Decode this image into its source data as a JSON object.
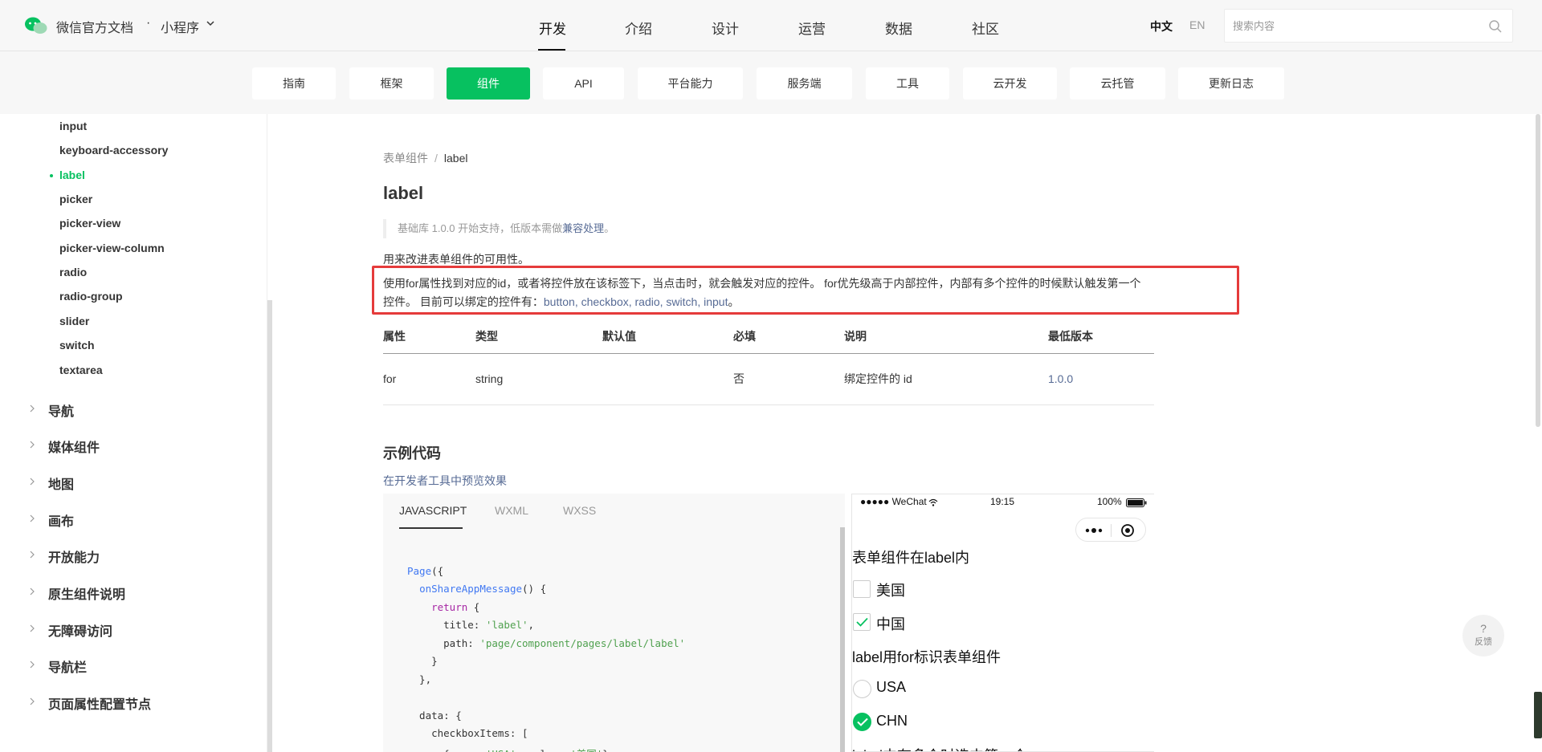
{
  "header": {
    "brand": "微信官方文档",
    "dot": "·",
    "product": "小程序",
    "nav": [
      "开发",
      "介绍",
      "设计",
      "运营",
      "数据",
      "社区"
    ],
    "lang_zh": "中文",
    "lang_en": "EN",
    "search_placeholder": "搜索内容"
  },
  "subnav": {
    "tabs": [
      "指南",
      "框架",
      "组件",
      "API",
      "平台能力",
      "服务端",
      "工具",
      "云开发",
      "云托管",
      "更新日志"
    ],
    "active": "组件"
  },
  "sidebar": {
    "sub_items": [
      "input",
      "keyboard-accessory",
      "label",
      "picker",
      "picker-view",
      "picker-view-column",
      "radio",
      "radio-group",
      "slider",
      "switch",
      "textarea"
    ],
    "active": "label",
    "groups": [
      "导航",
      "媒体组件",
      "地图",
      "画布",
      "开放能力",
      "原生组件说明",
      "无障碍访问",
      "导航栏",
      "页面属性配置节点"
    ]
  },
  "content": {
    "breadcrumb_parent": "表单组件",
    "breadcrumb_sep": "/",
    "breadcrumb_current": "label",
    "title": "label",
    "support_prefix": "基础库 1.0.0 开始支持，低版本需做",
    "support_link": "兼容处理",
    "support_suffix": "。",
    "desc1": "用来改进表单组件的可用性。",
    "desc2_line1": "使用for属性找到对应的id，或者将控件放在该标签下，当点击时，就会触发对应的控件。 for优先级高于内部控件，内部有多个控件的时候默认触发第一个",
    "desc2_line2_prefix": "控件。 目前可以绑定的控件有：",
    "desc2_controls": "button, checkbox, radio, switch, input",
    "desc2_suffix": "。",
    "table": {
      "headers": [
        "属性",
        "类型",
        "默认值",
        "必填",
        "说明",
        "最低版本"
      ],
      "rows": [
        [
          "for",
          "string",
          "",
          "否",
          "绑定控件的 id",
          "1.0.0"
        ]
      ]
    },
    "example_title": "示例代码",
    "preview_link": "在开发者工具中预览效果"
  },
  "code": {
    "tabs": [
      "JAVASCRIPT",
      "WXML",
      "WXSS"
    ],
    "active": "JAVASCRIPT",
    "lines": [
      "Page({",
      "  onShareAppMessage() {",
      "    return {",
      "      title: 'label',",
      "      path: 'page/component/pages/label/label'",
      "    }",
      "  },",
      "",
      "  data: {",
      "    checkboxItems: [",
      "      {name: 'USA', value: '美国'},"
    ]
  },
  "phone": {
    "carrier": "●●●●● WeChat",
    "time": "19:15",
    "battery": "100%",
    "section1_title": "表单组件在label内",
    "checkbox_items": [
      {
        "label": "美国",
        "checked": false
      },
      {
        "label": "中国",
        "checked": true
      }
    ],
    "section2_title": "label用for标识表单组件",
    "radio_items": [
      {
        "label": "USA",
        "checked": false
      },
      {
        "label": "CHN",
        "checked": true
      }
    ],
    "section3_title_partial": "label中有多个时选中第一个"
  },
  "feedback": {
    "icon": "?",
    "label": "反馈"
  },
  "colors": {
    "accent": "#07c160",
    "link": "#576b95",
    "highlight_border": "#e53b3b"
  }
}
